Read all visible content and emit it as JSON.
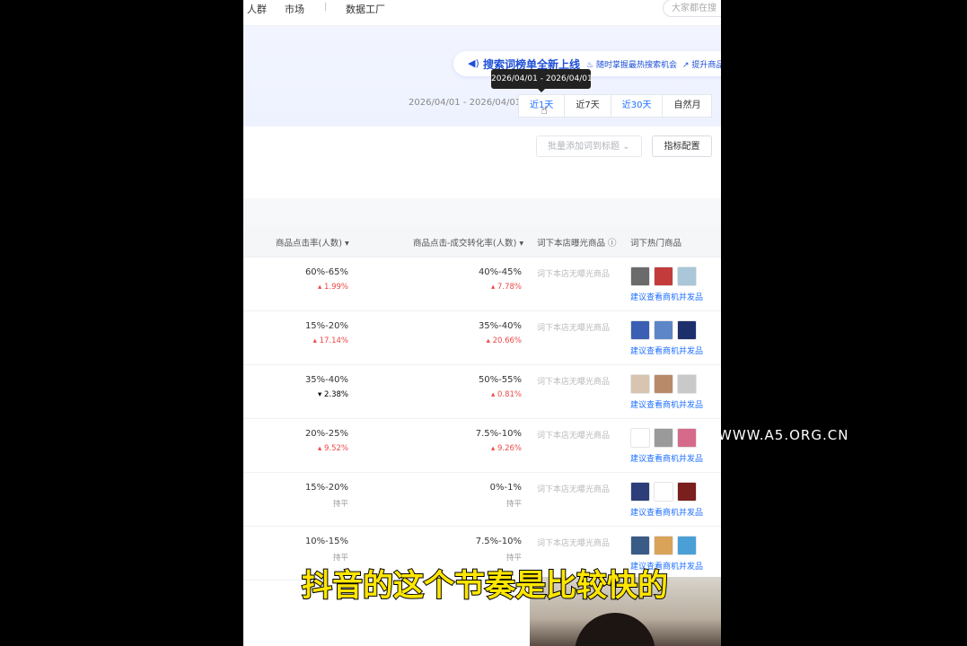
{
  "nav": {
    "items": [
      "人群",
      "市场",
      "数据工厂"
    ],
    "search_placeholder": "大家都在搜"
  },
  "banner": {
    "title": "搜索词榜单全新上线",
    "sub1": "随时掌握最热搜索机会",
    "sub2": "提升商品"
  },
  "date_range": "2026/04/01 - 2026/04/01",
  "tooltip": "2026/04/01 - 2026/04/01",
  "period_tabs": [
    "近1天",
    "近7天",
    "近30天",
    "自然月"
  ],
  "toolbar": {
    "batch_add": "批量添加词到标题",
    "metric_config": "指标配置"
  },
  "table": {
    "headers": [
      "商品点击率(人数)",
      "商品点击-成交转化率(人数)",
      "词下本店曝光商品",
      "词下热门商品"
    ],
    "rows": [
      {
        "ctr": "60%-65%",
        "ctr_delta": "1.99%",
        "ctr_dir": "up",
        "cvr": "40%-45%",
        "cvr_delta": "7.78%",
        "cvr_dir": "up",
        "shop": "词下本店无曝光商品",
        "link": "建议查看商机并发品"
      },
      {
        "ctr": "15%-20%",
        "ctr_delta": "17.14%",
        "ctr_dir": "up",
        "cvr": "35%-40%",
        "cvr_delta": "20.66%",
        "cvr_dir": "up",
        "shop": "词下本店无曝光商品",
        "link": "建议查看商机并发品"
      },
      {
        "ctr": "35%-40%",
        "ctr_delta": "2.38%",
        "ctr_dir": "down",
        "cvr": "50%-55%",
        "cvr_delta": "0.81%",
        "cvr_dir": "up",
        "shop": "词下本店无曝光商品",
        "link": "建议查看商机并发品"
      },
      {
        "ctr": "20%-25%",
        "ctr_delta": "9.52%",
        "ctr_dir": "up",
        "cvr": "7.5%-10%",
        "cvr_delta": "9.26%",
        "cvr_dir": "up",
        "shop": "词下本店无曝光商品",
        "link": "建议查看商机并发品"
      },
      {
        "ctr": "15%-20%",
        "ctr_delta": "持平",
        "ctr_dir": "flat",
        "cvr": "0%-1%",
        "cvr_delta": "持平",
        "cvr_dir": "flat",
        "shop": "词下本店无曝光商品",
        "link": "建议查看商机并发品"
      },
      {
        "ctr": "10%-15%",
        "ctr_delta": "持平",
        "ctr_dir": "flat",
        "cvr": "7.5%-10%",
        "cvr_delta": "持平",
        "cvr_dir": "flat",
        "shop": "词下本店无曝光商品",
        "link": "建议查看商机并发品"
      }
    ],
    "thumb_colors": [
      [
        "#6b6b6b",
        "#c43b3b",
        "#a9c7d8"
      ],
      [
        "#3a5fb3",
        "#5d86c9",
        "#1d2f6b"
      ],
      [
        "#d8c4b0",
        "#b98a6a",
        "#c9c9c9"
      ],
      [
        "#ffffff",
        "#9a9a9a",
        "#d66a8a"
      ],
      [
        "#2c3d7a",
        "#ffffff",
        "#7a1e1e"
      ],
      [
        "#3a5b86",
        "#d9a35a",
        "#4aa0d6"
      ]
    ]
  },
  "watermark": "WWW.A5.ORG.CN",
  "subtitle": "抖音的这个节奏是比较快的"
}
